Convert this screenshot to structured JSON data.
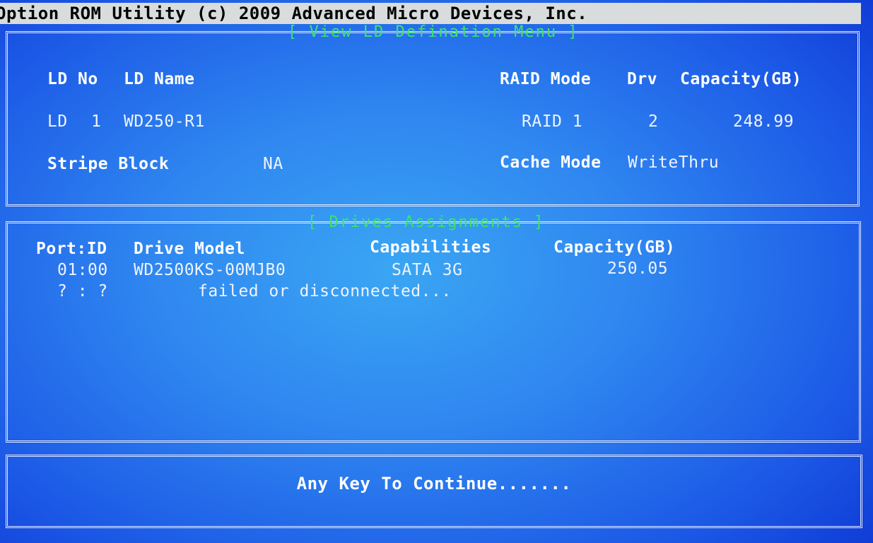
{
  "titlebar": {
    "text": "Option ROM Utility (c) 2009 Advanced Micro Devices, Inc."
  },
  "ld_panel": {
    "title": "[ View LD Defination Menu ]",
    "headers": {
      "ld_no": "LD No",
      "ld_name": "LD Name",
      "raid_mode": "RAID Mode",
      "drv": "Drv",
      "capacity": "Capacity(GB)"
    },
    "row": {
      "ld_label": "LD",
      "ld_no": "1",
      "ld_name": "WD250-R1",
      "raid_mode": "RAID 1",
      "drv": "2",
      "capacity": "248.99"
    },
    "stripe_block_label": "Stripe Block",
    "stripe_block_value": "NA",
    "cache_mode_label": "Cache Mode",
    "cache_mode_value": "WriteThru"
  },
  "drives_panel": {
    "title": "[ Drives Assignments ]",
    "headers": {
      "port_id": "Port:ID",
      "drive_model": "Drive Model",
      "capabilities": "Capabilities",
      "capacity": "Capacity(GB)"
    },
    "rows": [
      {
        "port_id": "01:00",
        "drive_model": "WD2500KS-00MJB0",
        "capabilities": "SATA 3G",
        "capacity": "250.05"
      },
      {
        "port_id": "? : ?",
        "status": "failed or disconnected..."
      }
    ]
  },
  "footer": {
    "prompt": "Any Key To Continue......."
  },
  "colors": {
    "background": "#2f86f0",
    "titlebar_bg": "#d9dcdc",
    "panel_title": "#3de36a",
    "text": "#ffffff"
  }
}
